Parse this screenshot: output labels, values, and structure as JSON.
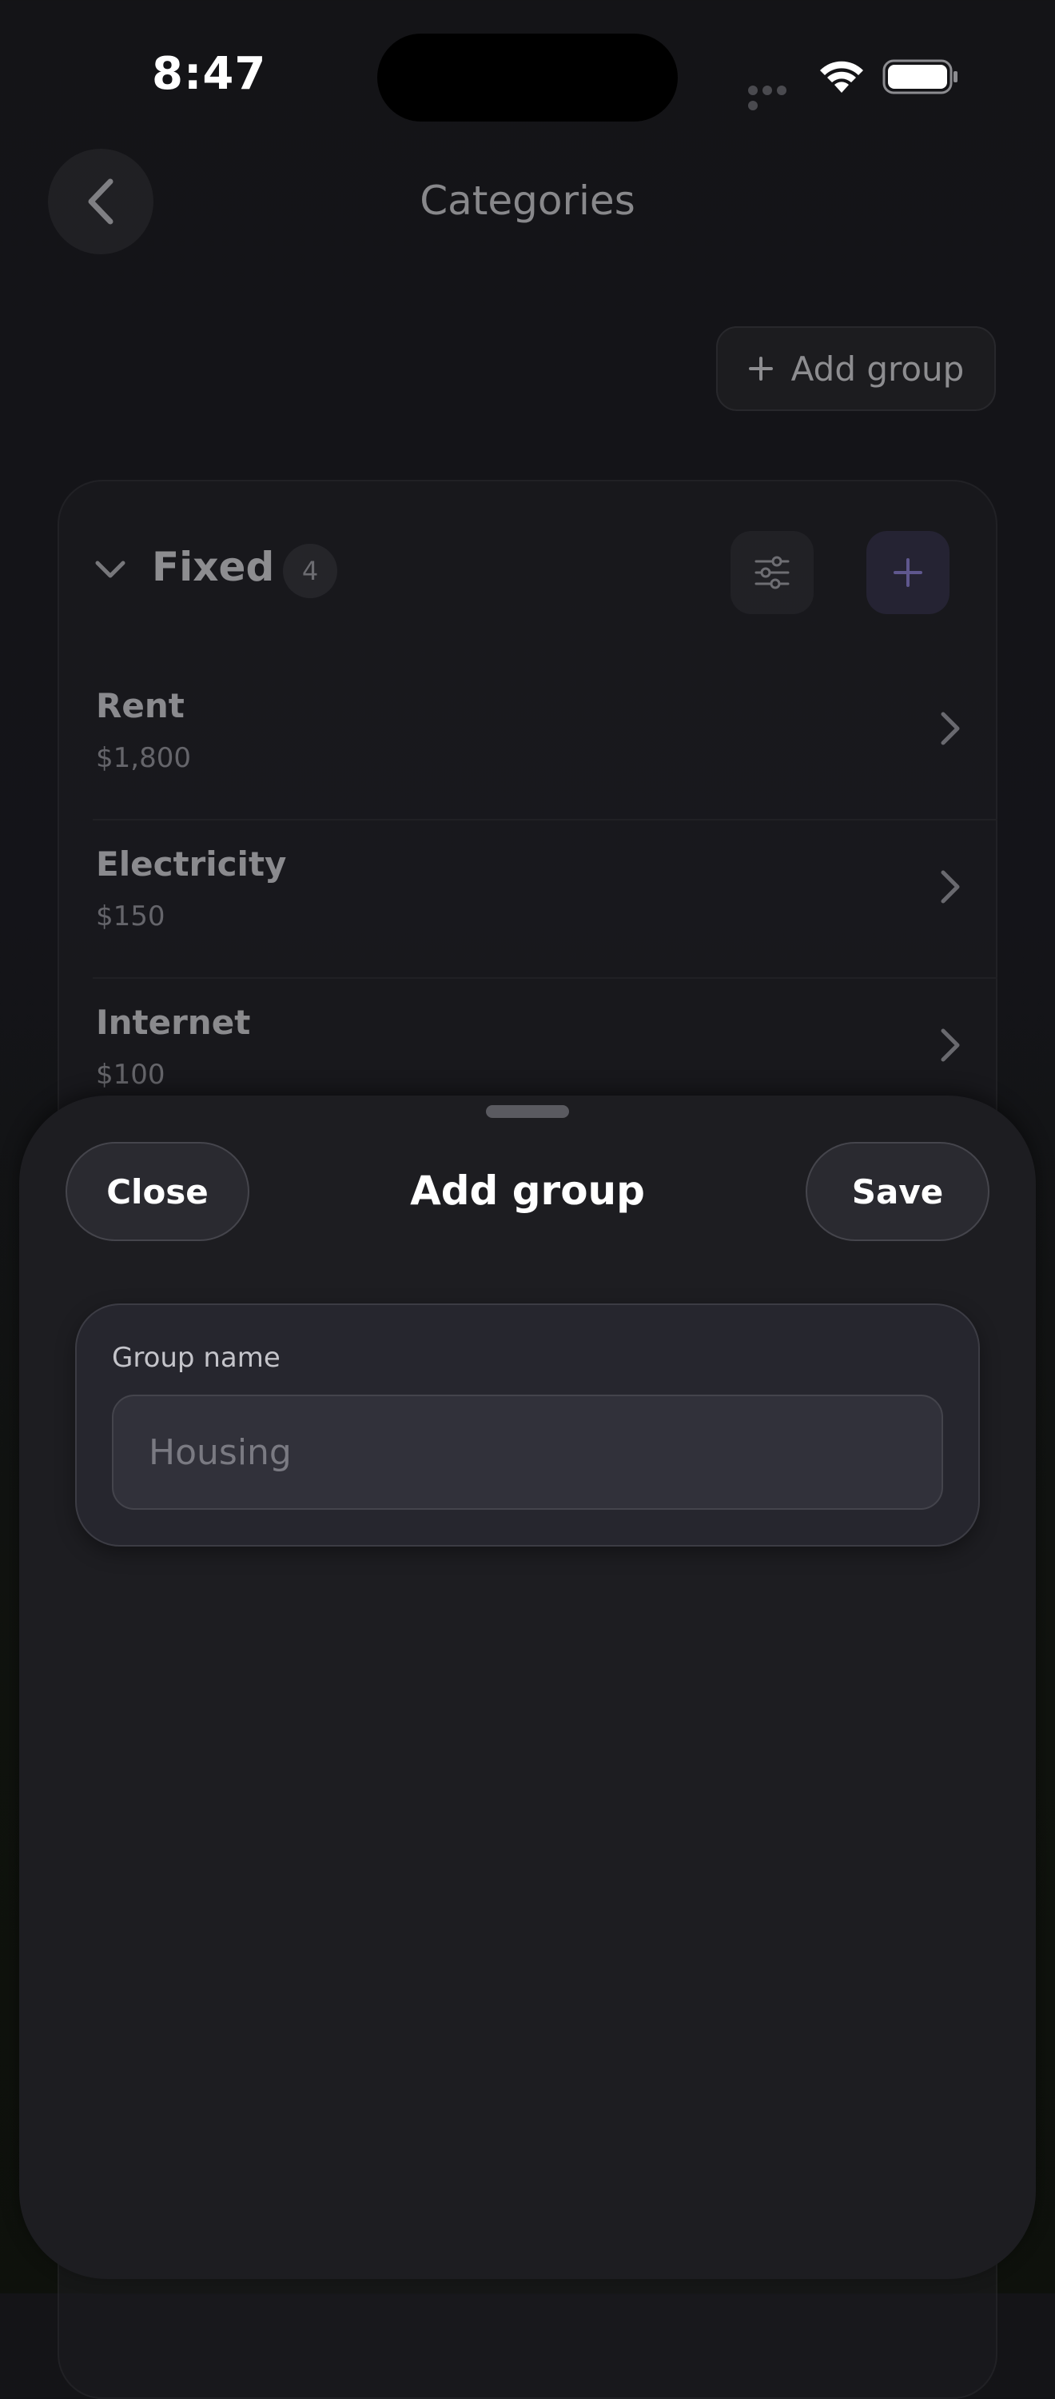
{
  "status_bar": {
    "time": "8:47"
  },
  "header": {
    "title": "Categories",
    "add_group_label": "Add group"
  },
  "group": {
    "name": "Fixed",
    "count": "4",
    "items": [
      {
        "name": "Rent",
        "amount": "$1,800"
      },
      {
        "name": "Electricity",
        "amount": "$150"
      },
      {
        "name": "Internet",
        "amount": "$100"
      }
    ]
  },
  "sheet": {
    "title": "Add group",
    "close_label": "Close",
    "save_label": "Save",
    "field_label": "Group name",
    "field_value": "",
    "field_placeholder": "Housing"
  },
  "colors": {
    "accent": "#8a7ee0",
    "sheet_bg": "#1d1d21",
    "page_bg": "#141417"
  }
}
